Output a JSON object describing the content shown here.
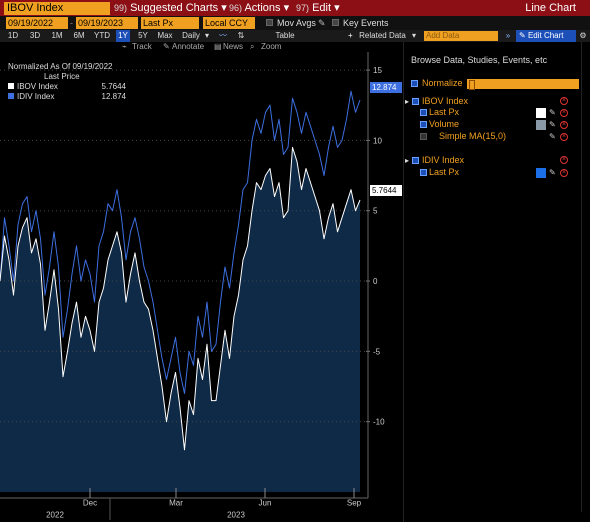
{
  "titlebar": {
    "ticker": "IBOV Index",
    "menu": [
      {
        "num": "99)",
        "label": "Suggested Charts",
        "caret": "▾"
      },
      {
        "num": "96)",
        "label": "Actions",
        "caret": "▾"
      },
      {
        "num": "97)",
        "label": "Edit",
        "caret": "▾"
      }
    ],
    "chart_type": "Line Chart"
  },
  "controls": {
    "start_date": "09/19/2022",
    "end_date": "09/19/2023",
    "field": "Last Px",
    "currency": "Local CCY",
    "mov_avgs": "Mov Avgs",
    "key_events": "Key Events"
  },
  "periods": [
    "1D",
    "3D",
    "1M",
    "6M",
    "YTD",
    "1Y",
    "5Y",
    "Max"
  ],
  "active_period": "1Y",
  "frequency": "Daily",
  "toolbar": {
    "table": "Table",
    "related": "Related Data",
    "add_data_placeholder": "Add Data",
    "edit_chart": "Edit Chart",
    "track": "Track",
    "annotate": "Annotate",
    "news": "News",
    "zoom": "Zoom"
  },
  "legend": {
    "title": "Normalized As Of 09/19/2022",
    "subtitle": "Last Price",
    "rows": [
      {
        "name": "IBOV Index",
        "value": "5.7644",
        "color": "#ffffff"
      },
      {
        "name": "IDIV Index",
        "value": "12.874",
        "color": "#3d6fe0"
      }
    ]
  },
  "value_tags": {
    "idiv": "12.874",
    "ibov": "5.7644"
  },
  "panel": {
    "title": "Browse Data, Studies, Events, etc",
    "normalize": "Normalize",
    "ibov": {
      "name": "IBOV Index",
      "last_px": "Last Px",
      "volume": "Volume",
      "sma": "Simple MA(15,0)"
    },
    "idiv": {
      "name": "IDIV Index",
      "last_px": "Last Px"
    }
  },
  "chart_data": {
    "type": "line",
    "y_ticks": [
      15,
      10,
      5,
      0,
      -5,
      -10
    ],
    "ylim": [
      -15,
      16
    ],
    "x_month_labels": [
      "Dec",
      "Mar",
      "Jun",
      "Sep"
    ],
    "x_year_labels": [
      "2022",
      "2023"
    ],
    "series": [
      {
        "name": "IBOV Index",
        "color": "#ffffff",
        "values": [
          0,
          3.2,
          1.5,
          -1.0,
          2.5,
          3.8,
          4.5,
          2.0,
          3.0,
          1.2,
          -3.5,
          -1.5,
          0.8,
          -2.0,
          -6.8,
          -5.0,
          -3.0,
          -1.5,
          -4.0,
          -2.5,
          -3.5,
          -5.0,
          -1.5,
          -0.5,
          1.5,
          2.5,
          3.5,
          2.0,
          -1.5,
          0.5,
          2.0,
          0.0,
          -1.5,
          -2.0,
          -3.5,
          -5.5,
          -7.5,
          -10.0,
          -8.0,
          -6.5,
          -9.0,
          -12.0,
          -8.5,
          -9.5,
          -5.5,
          -7.0,
          -4.5,
          -8.5,
          -8.5,
          -6.0,
          -3.5,
          -5.5,
          -2.5,
          -1.0,
          1.5,
          2.5,
          5.0,
          7.0,
          6.5,
          7.5,
          8.0,
          6.0,
          7.0,
          4.5,
          5.0,
          9.5,
          8.5,
          6.5,
          8.0,
          7.0,
          6.0,
          5.0,
          3.0,
          4.5,
          5.5,
          3.5,
          4.5,
          5.5,
          6.5,
          5.0,
          5.7644
        ]
      },
      {
        "name": "IDIV Index",
        "color": "#3d6fe0",
        "values": [
          0,
          4.5,
          2.5,
          0.0,
          4.0,
          5.5,
          6.0,
          3.5,
          5.0,
          3.0,
          -1.0,
          1.0,
          3.5,
          1.0,
          -4.0,
          -2.0,
          0.5,
          2.5,
          0.0,
          1.5,
          0.5,
          -1.5,
          2.5,
          3.5,
          5.5,
          5.0,
          6.5,
          4.5,
          1.5,
          3.5,
          4.5,
          3.0,
          1.0,
          0.0,
          -1.5,
          -3.5,
          -5.5,
          -7.0,
          -5.5,
          -4.0,
          -6.5,
          -8.0,
          -5.0,
          -6.0,
          -2.5,
          -4.0,
          -1.5,
          -5.0,
          -4.5,
          -1.5,
          1.0,
          -0.5,
          2.0,
          4.0,
          6.5,
          7.0,
          10.0,
          11.5,
          10.5,
          12.0,
          12.5,
          10.0,
          11.5,
          9.0,
          9.5,
          13.0,
          12.0,
          10.5,
          12.0,
          11.0,
          10.0,
          9.0,
          7.5,
          9.5,
          11.0,
          9.5,
          10.0,
          11.5,
          13.5,
          12.0,
          12.874
        ]
      }
    ]
  }
}
